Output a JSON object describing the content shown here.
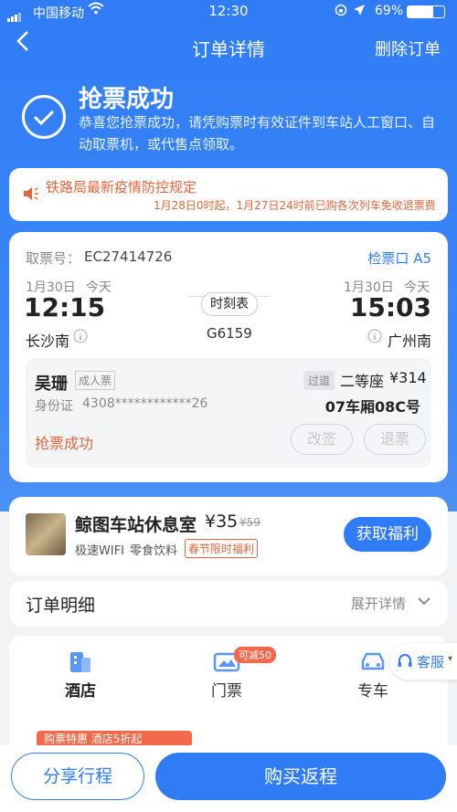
{
  "status_bar": {
    "carrier": "中国移动",
    "time": "12:30",
    "battery": "69%"
  },
  "nav": {
    "title": "订单详情",
    "delete_label": "删除订单"
  },
  "success": {
    "title": "抢票成功",
    "message": "恭喜您抢票成功，请凭购票时有效证件到车站人工窗口、自动取票机，或代售点领取。"
  },
  "notice": {
    "title": "铁路局最新疫情防控规定",
    "detail": "1月28日0时起，1月27日24时前已购各次列车免收退票费"
  },
  "ticket": {
    "pickup_label": "取票号：",
    "pickup_code": "EC27414726",
    "gate": "检票口 A5",
    "depart_date": "1月30日",
    "depart_day": "今天",
    "depart_time": "12:15",
    "depart_station": "长沙南",
    "arrive_date": "1月30日",
    "arrive_day": "今天",
    "arrive_time": "15:03",
    "arrive_station": "广州南",
    "timetable_label": "时刻表",
    "train_no": "G6159"
  },
  "passenger": {
    "name": "吴珊",
    "ticket_type": "成人票",
    "id_label": "身份证",
    "id_number": "4308************26",
    "gate_status": "过道",
    "seat_class": "二等座",
    "price": "¥314",
    "seat": "07车厢08C号",
    "status": "抢票成功",
    "change_label": "改签",
    "refund_label": "退票"
  },
  "lounge": {
    "name": "鲸图车站休息室",
    "price": "¥35",
    "original_price": "¥59",
    "tag1": "极速WIFI",
    "tag2": "零食饮料",
    "promo": "春节限时福利",
    "button": "获取福利"
  },
  "order_detail": {
    "title": "订单明细",
    "expand_label": "展开详情"
  },
  "services": {
    "hotel": "酒店",
    "tickets": "门票",
    "tickets_badge": "可减50",
    "car": "专车",
    "promo_strip": "购票特惠 酒店5折起"
  },
  "kefu": {
    "label": "客服"
  },
  "bottom": {
    "share": "分享行程",
    "return": "购买返程"
  },
  "colors": {
    "primary": "#2f7cf6",
    "warning": "#e4653a",
    "promo": "#f26a4b"
  }
}
